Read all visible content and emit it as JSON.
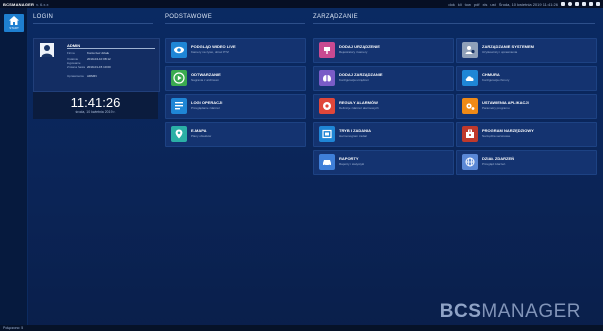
{
  "app": {
    "brand": "BCSMANAGER",
    "brand_sub": "v. 6.x.x",
    "topbar_info": "Środa, 10 kwietnia 2019 11:41:26",
    "topbar_small": [
      "dok",
      "kli",
      "tow",
      "pdf",
      "xls",
      "ust"
    ]
  },
  "sidebar": {
    "home_label": "START"
  },
  "sections": {
    "login": "LOGIN",
    "base": "PODSTAWOWE",
    "manage": "ZARZĄDZANIE"
  },
  "login_panel": {
    "user": "ADMIN",
    "rows": [
      {
        "k": "Firma",
        "v": "Konto bez działu"
      },
      {
        "k": "Ostatnie logowanie",
        "v": "2019-04-10 08:12"
      },
      {
        "k": "Zmiana hasła",
        "v": "2019-01-15 10:00"
      },
      {
        "k": "Uprawnienia",
        "v": "ADMIN"
      }
    ],
    "time": "11:41:26",
    "date": "środa, 10 kwietnia 2019 r."
  },
  "tiles_base": [
    {
      "title": "PODGLĄD WIDEO LIVE",
      "sub": "Kamery na żywo, obraz PTZ",
      "color": "#1f86d6",
      "icon": "eye-icon"
    },
    {
      "title": "ODTWARZANIE",
      "sub": "Nagrania z archiwum",
      "color": "#3aaa4f",
      "icon": "play-icon"
    },
    {
      "title": "LOGI OPERACJI",
      "sub": "Przeglądanie zdarzeń",
      "color": "#1f86d6",
      "icon": "log-list-icon"
    },
    {
      "title": "E-MAPA",
      "sub": "Plany obiektów",
      "color": "#2bb0a6",
      "icon": "map-icon"
    }
  ],
  "tiles_manage_left": [
    {
      "title": "DODAJ URZĄDZENIE",
      "sub": "Rejestratory i kamery",
      "color": "#c84a91",
      "icon": "add-device-icon"
    },
    {
      "title": "DODAJ ZARZĄDZANIE",
      "sub": "Konfiguracja urządzeń",
      "color": "#7a5cc7",
      "icon": "lungs-icon"
    },
    {
      "title": "REGUŁY ALARMÓW",
      "sub": "Definicje zdarzeń alarmowych",
      "color": "#e0473a",
      "icon": "alarm-rule-icon"
    },
    {
      "title": "TRYB I ZADANIA",
      "sub": "Harmonogram zadań",
      "color": "#1f86d6",
      "icon": "task-icon"
    },
    {
      "title": "RAPORTY",
      "sub": "Raporty i statystyki",
      "color": "#3f7fd8",
      "icon": "car-icon"
    }
  ],
  "tiles_manage_right": [
    {
      "title": "ZARZĄDZANIE SYSTEMEM",
      "sub": "Użytkownicy i uprawnienia",
      "color": "#8fa0b9",
      "icon": "users-icon"
    },
    {
      "title": "CHMURA",
      "sub": "Konfiguracja chmury",
      "color": "#1f86d6",
      "icon": "cloud-icon"
    },
    {
      "title": "USTAWIENIA APLIKACJI",
      "sub": "Parametry programu",
      "color": "#f08a16",
      "icon": "settings-icon"
    },
    {
      "title": "PROGRAM NARZĘDZIOWY",
      "sub": "Narzędzia serwisowe",
      "color": "#c0392b",
      "icon": "toolbox-icon"
    },
    {
      "title": "DZIAŁ ZDARZEŃ",
      "sub": "Przegląd zdarzeń",
      "color": "#5a88d6",
      "icon": "globe-icon"
    }
  ],
  "footer": {
    "logo_bold": "BCS",
    "logo_rest": "MANAGER",
    "status": "Połączono: 5"
  }
}
